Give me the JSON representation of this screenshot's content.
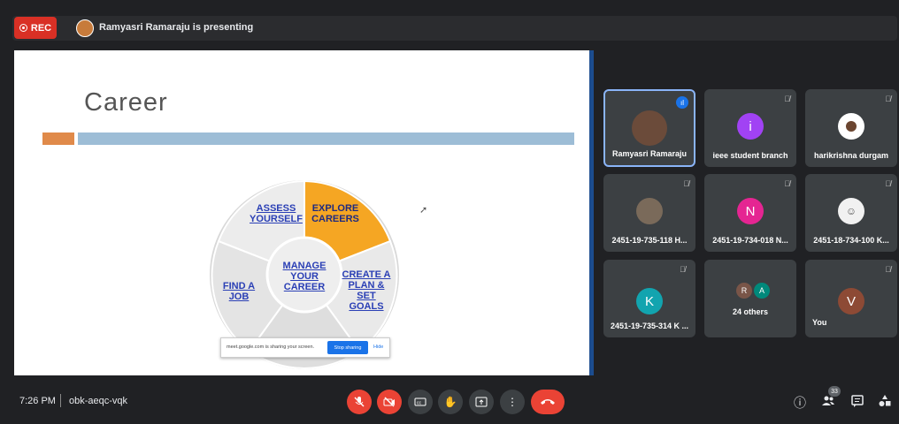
{
  "topbar": {
    "rec_label": "REC",
    "presenting_text": "Ramyasri Ramaraju is presenting"
  },
  "slide": {
    "title": "Career",
    "wheel": {
      "assess": "ASSESS YOURSELF",
      "explore": "EXPLORE CAREERS",
      "manage": "MANAGE YOUR CAREER",
      "create": "CREATE A PLAN & SET GOALS",
      "find": "FIND A JOB"
    },
    "share_notice": {
      "text": "meet.google.com is sharing your screen.",
      "stop_label": "Stop sharing",
      "hide_label": "Hide"
    }
  },
  "participants": [
    {
      "name": "Ramyasri Ramaraju",
      "initial": "",
      "color": "#6b4b3a",
      "speaking": true
    },
    {
      "name": "ieee student branch",
      "initial": "i",
      "color": "#a142f4"
    },
    {
      "name": "harikrishna durgam",
      "initial": "",
      "color": "#ffffff"
    },
    {
      "name": "2451-19-735-118 H...",
      "initial": "",
      "color": "#7a6a5a"
    },
    {
      "name": "2451-19-734-018 N...",
      "initial": "N",
      "color": "#e52592"
    },
    {
      "name": "2451-18-734-100 K...",
      "initial": "",
      "color": "#f1f1f1"
    },
    {
      "name": "2451-19-735-314 K ...",
      "initial": "K",
      "color": "#12a4af"
    },
    {
      "name": "24 others",
      "initials": [
        "R",
        "A"
      ],
      "colors": [
        "#795548",
        "#00897b"
      ]
    },
    {
      "name": "You",
      "initial": "V",
      "color": "#8d4a35"
    }
  ],
  "bottombar": {
    "time": "7:26 PM",
    "meeting_code": "obk-aeqc-vqk",
    "people_count": "33"
  }
}
